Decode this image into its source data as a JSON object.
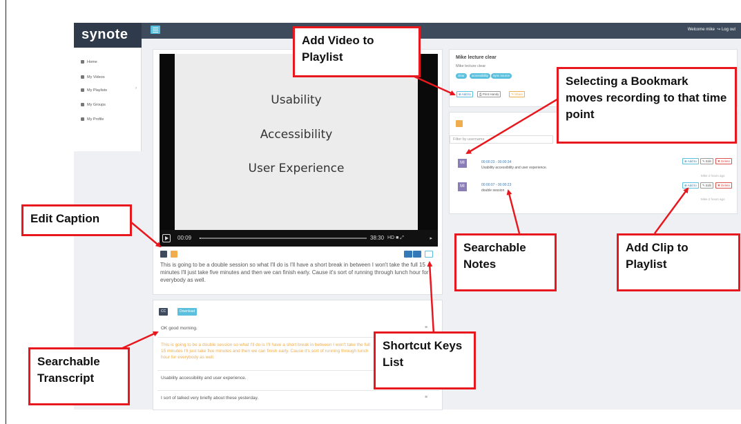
{
  "app": {
    "logo": "synote",
    "welcome": "Welcome mike",
    "logout": "Log out"
  },
  "sidebar": {
    "items": [
      {
        "label": "Home",
        "icon": "home-icon"
      },
      {
        "label": "My Videos",
        "icon": "video-icon"
      },
      {
        "label": "My Playlists",
        "icon": "list-icon"
      },
      {
        "label": "My Groups",
        "icon": "group-icon"
      },
      {
        "label": "My Profile",
        "icon": "user-icon"
      }
    ]
  },
  "video": {
    "slide_lines": [
      "Usability",
      "Accessibility",
      "User Experience"
    ],
    "current_time": "00:09",
    "duration": "38:30",
    "progress": 0.004,
    "quality": "HD"
  },
  "caption": {
    "text": "This is going to be a double session so what I'll do is I'll have a short break in between I won't take the full 15 minutes I'll just take five minutes and then we can finish early. Cause it's sort of running through lunch hour for everybody as well."
  },
  "transcript": {
    "cc_button": "CC",
    "download_button": "Download",
    "rows": [
      "OK good morning.",
      "This is going to be a double session so what I'll do is I'll have a short break in between I won't take the full 15 minutes I'll just take five minutes and then we can finish early. Cause it's sort of running through lunch hour for everybody as well.",
      "Usability accessibility and user experience.",
      "I sort of talked very briefly about these yesterday."
    ]
  },
  "recording": {
    "title": "Mike lecture clear",
    "subtitle": "Mike lecture clear",
    "tags": [
      "clear",
      "accessibility",
      "sync source"
    ],
    "add_to": "Add to",
    "print_handy": "Print Handy",
    "share": "Share"
  },
  "bookmarks": {
    "filter_placeholder": "Filter by username",
    "items": [
      {
        "avatar": "MI",
        "time": "00:00:23 - 00:00:34",
        "text": "Usability accessibility and user experience.",
        "meta": "Mike 2 hours ago"
      },
      {
        "avatar": "MI",
        "time": "00:00:07 - 00:00:23",
        "text": "double session",
        "meta": "Mike 2 hours ago"
      }
    ],
    "add_to": "Add to",
    "edit": "Edit",
    "delete": "Delete"
  },
  "callouts": {
    "add_video": "Add Video to Playlist",
    "selecting_bookmark": "Selecting a Bookmark moves recording to that time point",
    "edit_caption": "Edit Caption",
    "searchable_notes": "Searchable Notes",
    "add_clip": "Add Clip to Playlist",
    "searchable_transcript": "Searchable Transcript",
    "shortcut_keys": "Shortcut Keys List"
  },
  "colors": {
    "callout_border": "#e8171d",
    "topbar": "#3d4b5c",
    "accent": "#5bc0de",
    "orange": "#f0ad4e"
  }
}
